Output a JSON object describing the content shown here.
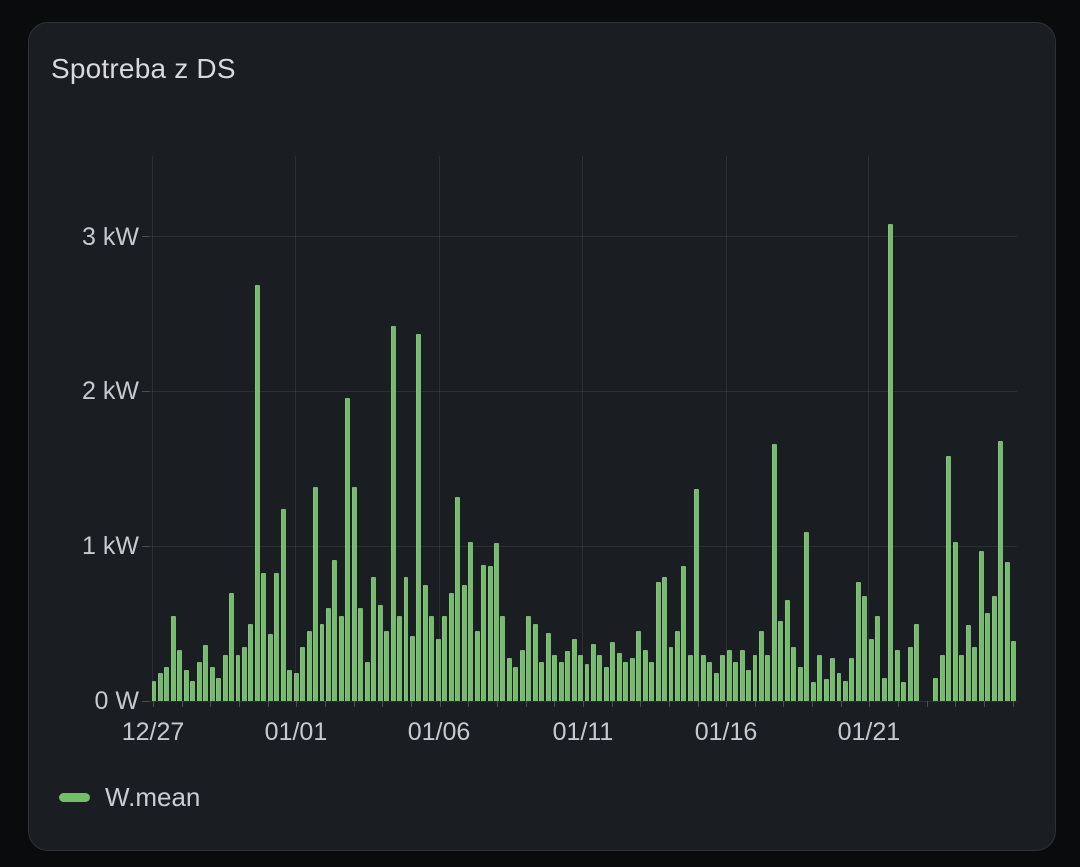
{
  "panel": {
    "title": "Spotreba z DS"
  },
  "legend": {
    "series_label": "W.mean",
    "swatch_color": "#73bf69"
  },
  "colors": {
    "page_background": "#0a0b0c",
    "panel_background": "#1a1d22",
    "panel_border": "#2e3237",
    "bar_green": "#77b96e",
    "grid": "rgba(204,204,220,0.10)",
    "axis_text": "#c8c9d0",
    "title_text": "#d8d9de"
  },
  "chart_data": {
    "type": "bar",
    "title": "Spotreba z DS",
    "xlabel": "",
    "ylabel": "",
    "grid": true,
    "legend_position": "bottom-left",
    "y_axis": {
      "tick_labels": [
        "3 kW",
        "2 kW",
        "1 kW",
        "0 W"
      ],
      "tick_values_kw": [
        3,
        2,
        1,
        0
      ],
      "ylim_kw": [
        0,
        3.52
      ]
    },
    "x_axis": {
      "tick_labels": [
        "12/27",
        "01/01",
        "01/06",
        "01/11",
        "01/16",
        "01/21"
      ],
      "major_tick_fractions": [
        0.0023,
        0.1674,
        0.3326,
        0.4988,
        0.664,
        0.829
      ],
      "minor_tick_count": 31,
      "minor_tick_step_fraction": 0.033093,
      "minor_tick_interval": "1 day"
    },
    "series": [
      {
        "name": "W.mean",
        "unit": "kW",
        "color": "#77b96e",
        "values_kw": [
          0.13,
          0.18,
          0.22,
          0.55,
          0.33,
          0.2,
          0.13,
          0.25,
          0.36,
          0.22,
          0.15,
          0.3,
          0.7,
          0.3,
          0.35,
          0.5,
          2.69,
          0.83,
          0.43,
          0.83,
          1.24,
          0.2,
          0.18,
          0.35,
          0.45,
          1.38,
          0.5,
          0.6,
          0.91,
          0.55,
          1.96,
          1.38,
          0.6,
          0.25,
          0.8,
          0.62,
          0.45,
          2.42,
          0.55,
          0.8,
          0.42,
          2.37,
          0.75,
          0.55,
          0.4,
          0.55,
          0.7,
          1.32,
          0.75,
          1.03,
          0.45,
          0.88,
          0.87,
          1.02,
          0.55,
          0.28,
          0.22,
          0.33,
          0.55,
          0.5,
          0.25,
          0.44,
          0.3,
          0.25,
          0.32,
          0.4,
          0.3,
          0.24,
          0.37,
          0.3,
          0.22,
          0.38,
          0.31,
          0.25,
          0.28,
          0.45,
          0.33,
          0.25,
          0.77,
          0.8,
          0.35,
          0.45,
          0.87,
          0.3,
          1.37,
          0.3,
          0.25,
          0.18,
          0.3,
          0.33,
          0.25,
          0.33,
          0.2,
          0.3,
          0.45,
          0.3,
          1.66,
          0.52,
          0.65,
          0.35,
          0.22,
          1.09,
          0.12,
          0.3,
          0.14,
          0.28,
          0.18,
          0.13,
          0.28,
          0.77,
          0.68,
          0.4,
          0.55,
          0.15,
          3.08,
          0.33,
          0.12,
          0.35,
          0.5,
          null,
          null,
          0.15,
          0.3,
          1.58,
          1.03,
          0.3,
          0.49,
          0.35,
          0.97,
          0.57,
          0.68,
          1.68,
          0.9,
          0.39
        ]
      }
    ]
  }
}
